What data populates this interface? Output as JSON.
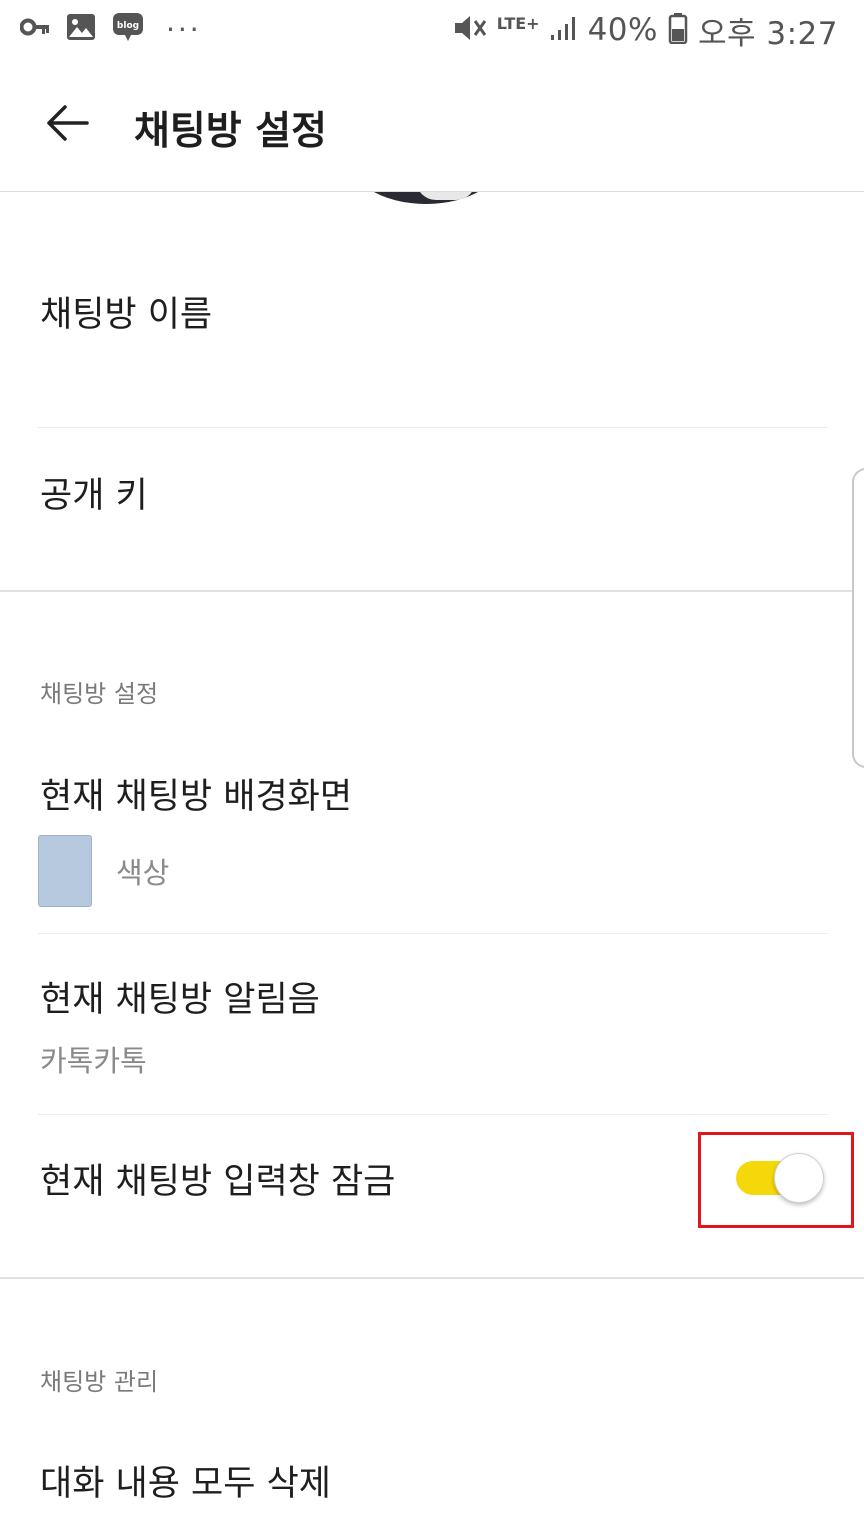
{
  "status_bar": {
    "left_icons": [
      "key-icon",
      "image-icon",
      "blog-icon",
      "more-dots-icon"
    ],
    "blog_label": "blog",
    "dots": "···",
    "network": "LTE+",
    "battery_percent": "40%",
    "time": "오후 3:27"
  },
  "header": {
    "back_icon": "arrow-left-icon",
    "title": "채팅방 설정"
  },
  "info": {
    "room_name_label": "채팅방 이름",
    "public_key_label": "공개 키"
  },
  "chat_settings": {
    "section_label": "채팅방 설정",
    "background_label": "현재 채팅방 배경화면",
    "background_value": "색상",
    "background_color": "#b6c9de",
    "sound_label": "현재 채팅방 알림음",
    "sound_value": "카톡카톡",
    "input_lock_label": "현재 채팅방 입력창 잠금",
    "input_lock_on": true,
    "toggle_color": "#f5d80a",
    "highlight_color": "#e3141d"
  },
  "management": {
    "section_label": "채팅방 관리",
    "delete_all_label": "대화 내용 모두 삭제"
  }
}
